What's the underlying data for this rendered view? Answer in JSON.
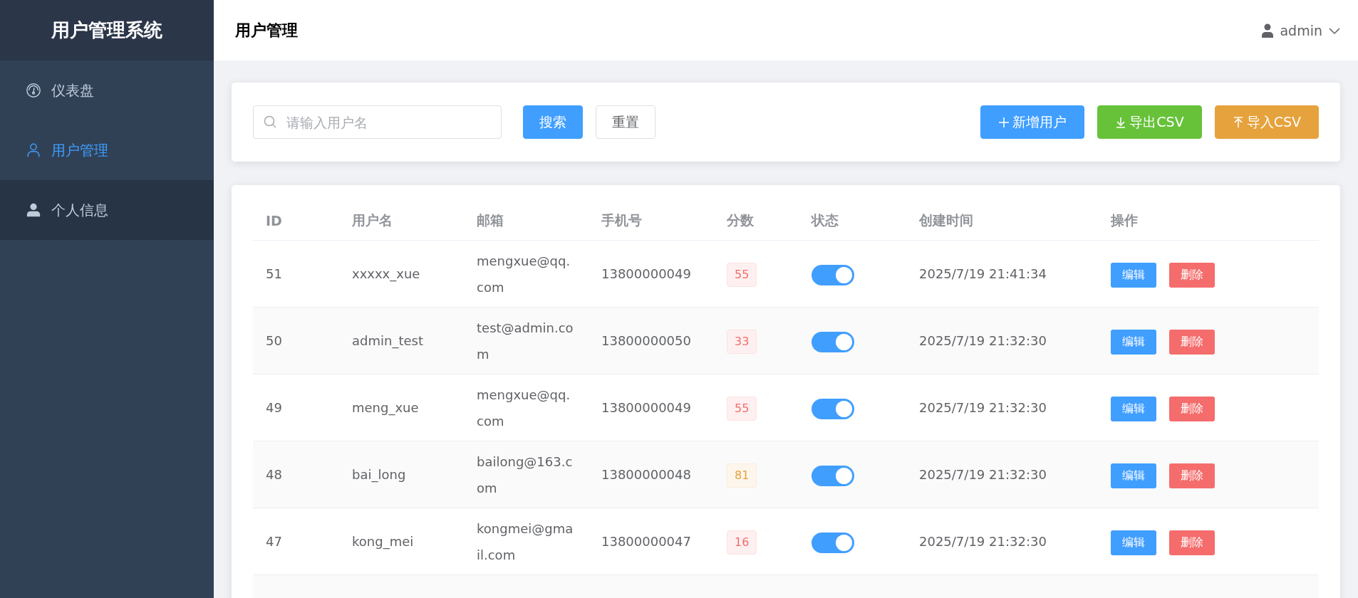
{
  "sidebar": {
    "title": "用户管理系统",
    "items": [
      {
        "label": "仪表盘",
        "selected": false,
        "hovered": false
      },
      {
        "label": "用户管理",
        "selected": true,
        "hovered": false
      },
      {
        "label": "个人信息",
        "selected": false,
        "hovered": true
      }
    ]
  },
  "header": {
    "title": "用户管理",
    "user": "admin"
  },
  "toolbar": {
    "search": {
      "placeholder": "请输入用户名"
    },
    "search_button": "搜索",
    "reset_button": "重置",
    "actions": [
      {
        "label": "新增用户",
        "kind": "add"
      },
      {
        "label": "导出CSV",
        "kind": "export"
      },
      {
        "label": "导入CSV",
        "kind": "import"
      }
    ]
  },
  "table": {
    "columns": [
      "ID",
      "用户名",
      "邮箱",
      "手机号",
      "分数",
      "状态",
      "创建时间",
      "操作"
    ],
    "rows": [
      {
        "id": "51",
        "username": "xxxxx_xue",
        "email": "mengxue@qq.com",
        "phone": "13800000049",
        "score": {
          "value": "55",
          "kind": "danger"
        },
        "on": true,
        "created": "2025/7/19 21:41:34",
        "edit": "编辑",
        "delete": "删除"
      },
      {
        "id": "50",
        "username": "admin_test",
        "email": "test@admin.com",
        "phone": "13800000050",
        "score": {
          "value": "33",
          "kind": "danger"
        },
        "on": true,
        "created": "2025/7/19 21:32:30",
        "edit": "编辑",
        "delete": "删除"
      },
      {
        "id": "49",
        "username": "meng_xue",
        "email": "mengxue@qq.com",
        "phone": "13800000049",
        "score": {
          "value": "55",
          "kind": "danger"
        },
        "on": true,
        "created": "2025/7/19 21:32:30",
        "edit": "编辑",
        "delete": "删除"
      },
      {
        "id": "48",
        "username": "bai_long",
        "email": "bailong@163.com",
        "phone": "13800000048",
        "score": {
          "value": "81",
          "kind": "warning"
        },
        "on": true,
        "created": "2025/7/19 21:32:30",
        "edit": "编辑",
        "delete": "删除"
      },
      {
        "id": "47",
        "username": "kong_mei",
        "email": "kongmei@gmail.com",
        "phone": "13800000047",
        "score": {
          "value": "16",
          "kind": "danger"
        },
        "on": true,
        "created": "2025/7/19 21:32:30",
        "edit": "编辑",
        "delete": "删除"
      }
    ]
  }
}
